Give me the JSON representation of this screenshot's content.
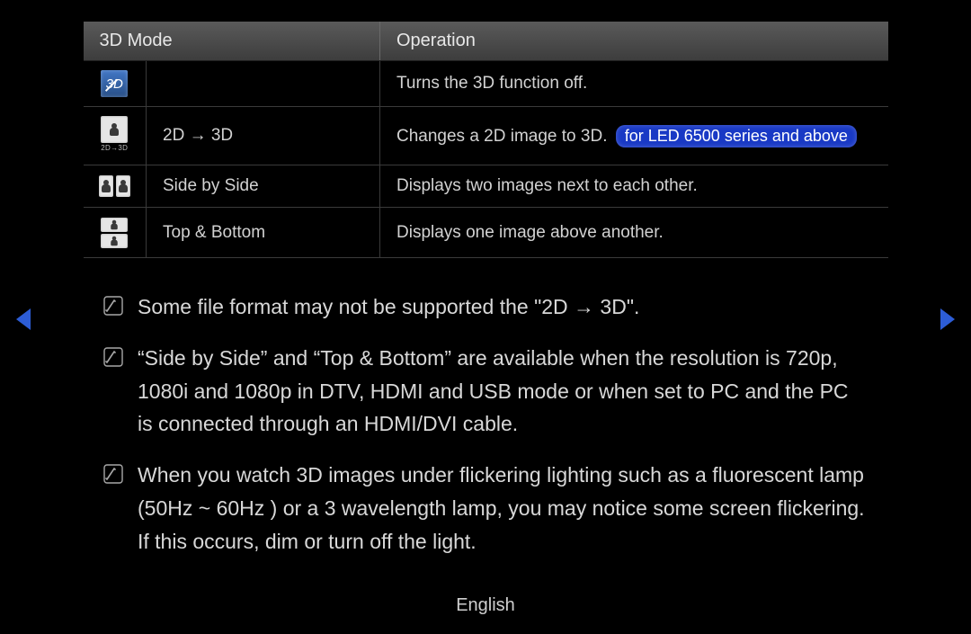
{
  "table": {
    "headers": {
      "mode": "3D Mode",
      "operation": "Operation"
    },
    "rows": [
      {
        "icon": "3d-off",
        "mode": "",
        "operation": "Turns the 3D function off.",
        "badge": ""
      },
      {
        "icon": "2d-3d",
        "icon_caption": "2D→3D",
        "mode": "2D → 3D",
        "operation": "Changes a 2D image to 3D.",
        "badge": "for LED 6500 series and above"
      },
      {
        "icon": "side-by-side",
        "mode": "Side by Side",
        "operation": "Displays two images next to each other.",
        "badge": ""
      },
      {
        "icon": "top-bottom",
        "mode": "Top & Bottom",
        "operation": "Displays one image above another.",
        "badge": ""
      }
    ]
  },
  "notes": [
    "Some file format may not be supported the \"2D → 3D\".",
    "“Side by Side” and “Top & Bottom” are available when the resolution is 720p, 1080i and 1080p in DTV, HDMI and USB mode or when set to PC and the PC is connected through an HDMI/DVI cable.",
    "When you watch 3D images under flickering lighting such as a fluorescent lamp (50Hz ~ 60Hz ) or a 3 wavelength lamp, you may notice some screen flickering. If this occurs, dim or turn off the light."
  ],
  "off_glyph": "3D",
  "footer": "English"
}
